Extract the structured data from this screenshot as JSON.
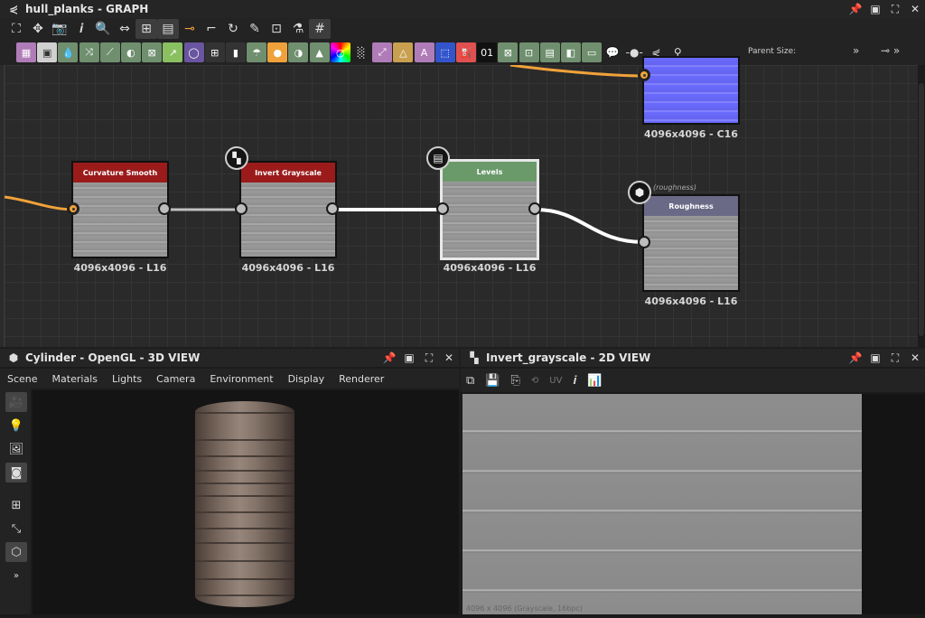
{
  "graph": {
    "title": "hull_planks - GRAPH",
    "parent_size_label": "Parent Size:",
    "nodes": [
      {
        "title": "Curvature Smooth",
        "res": "4096x4096 - L16",
        "color": "#9b1b1b"
      },
      {
        "title": "Invert Grayscale",
        "res": "4096x4096 - L16",
        "color": "#9b1b1b"
      },
      {
        "title": "Levels",
        "res": "4096x4096 - L16",
        "color": "#6b9a6a"
      },
      {
        "title": "Roughness",
        "res": "4096x4096 - L16",
        "color": "#6a6a86",
        "tag": "(roughness)"
      },
      {
        "title": "",
        "res": "4096x4096 - C16",
        "color": "#7777ee"
      }
    ]
  },
  "view3d": {
    "title": "Cylinder - OpenGL - 3D VIEW",
    "menu": [
      "Scene",
      "Materials",
      "Lights",
      "Camera",
      "Environment",
      "Display",
      "Renderer"
    ]
  },
  "view2d": {
    "title": "Invert_grayscale - 2D VIEW",
    "uv_label": "UV",
    "status": "4096 x 4096 (Grayscale, 16bpc)"
  }
}
